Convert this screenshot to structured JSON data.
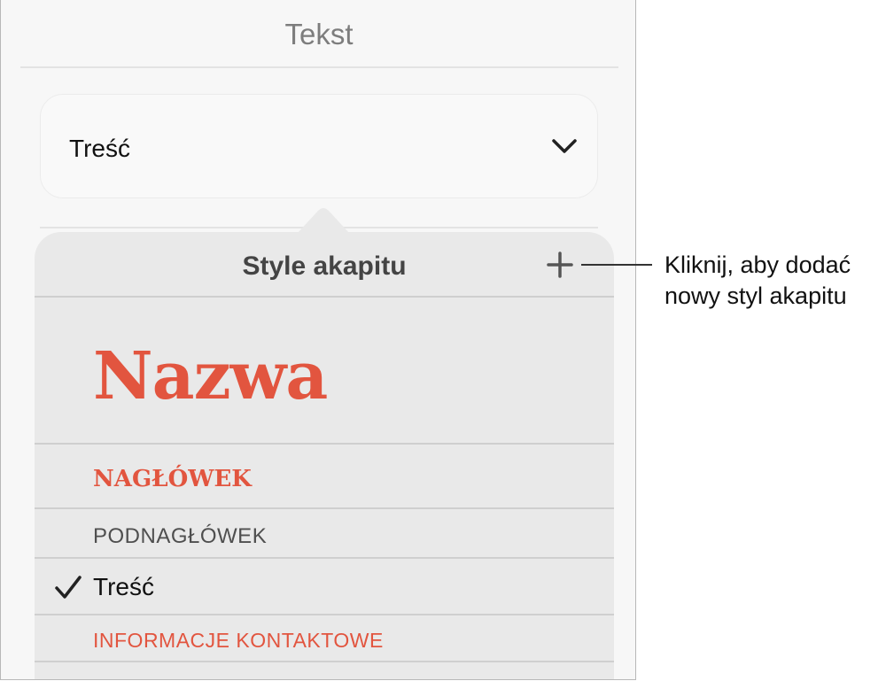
{
  "panel": {
    "title": "Tekst",
    "current_style": "Treść"
  },
  "popover": {
    "title": "Style akapitu",
    "styles": [
      {
        "label": "Nazwa"
      },
      {
        "label": "NAGŁÓWEK"
      },
      {
        "label": "PODNAGŁÓWEK"
      },
      {
        "label": "Treść",
        "selected": true
      },
      {
        "label": "INFORMACJE KONTAKTOWE"
      }
    ]
  },
  "callout": {
    "line1": "Kliknij, aby dodać",
    "line2": "nowy styl akapitu"
  },
  "icons": {
    "chevron": "chevron-down-icon",
    "plus": "plus-icon",
    "checkmark": "checkmark-icon"
  },
  "colors": {
    "accent": "#e2553f",
    "popover_bg": "#e9e9e9",
    "panel_bg": "#f7f7f7"
  }
}
